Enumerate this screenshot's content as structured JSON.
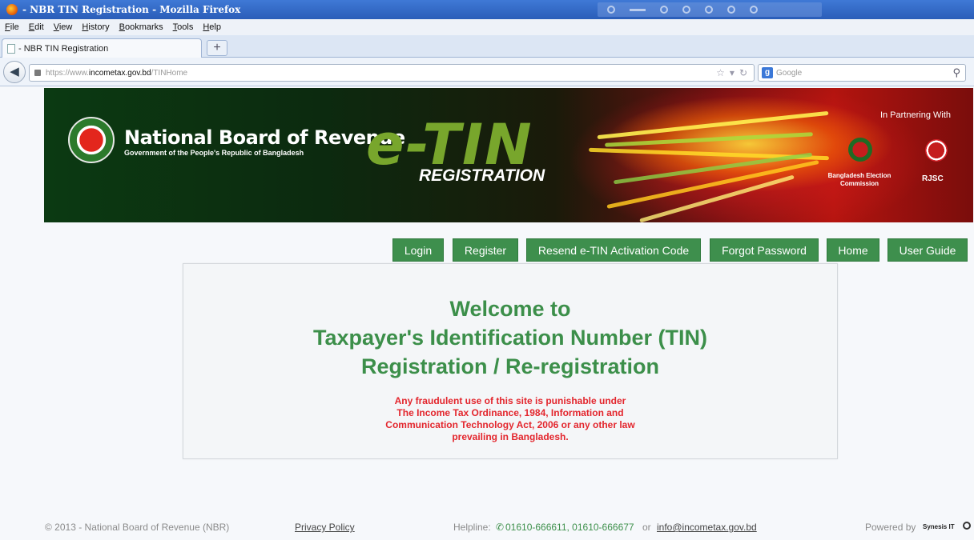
{
  "browser": {
    "window_title": " - NBR TIN Registration - Mozilla Firefox",
    "menu": [
      "File",
      "Edit",
      "View",
      "History",
      "Bookmarks",
      "Tools",
      "Help"
    ],
    "tab_title": " - NBR TIN Registration",
    "newtab_label": "+",
    "url_prefix": "https://www.",
    "url_domain": "incometax.gov.bd",
    "url_path": "/TINHome",
    "search_engine_label": "Google",
    "search_engine_icon": "google-icon"
  },
  "banner": {
    "org_title": "National Board of Revenue",
    "org_subtitle": "Government of the People's Republic of Bangladesh",
    "etin": "e-TIN",
    "etin_sub": "REGISTRATION",
    "partner_heading": "In Partnering With",
    "partner_1": "Bangladesh Election Commission",
    "partner_2": "RJSC"
  },
  "nav": {
    "login": "Login",
    "register": "Register",
    "resend": "Resend e-TIN Activation Code",
    "forgot": "Forgot Password",
    "home": "Home",
    "guide": "User Guide"
  },
  "welcome": {
    "line1": "Welcome to",
    "line2": "Taxpayer's Identification Number (TIN)",
    "line3": "Registration / Re-registration",
    "warning": [
      "Any fraudulent use of this site is punishable under",
      "The Income Tax Ordinance, 1984, Information and",
      "Communication Technology Act, 2006 or any other law",
      "prevailing in Bangladesh."
    ]
  },
  "footer": {
    "copyright": "© 2013 - National Board of Revenue (NBR)",
    "privacy": "Privacy Policy",
    "helpline_label": "Helpline:",
    "helpline_numbers": "01610-666611, 01610-666677",
    "or": "or",
    "email": "info@incometax.gov.bd",
    "powered_by": "Powered by",
    "powered_name": "Synesis IT"
  },
  "colors": {
    "accent_green": "#3e8f4d",
    "warning_red": "#e3262d",
    "heading_green": "#3c8f4a"
  }
}
